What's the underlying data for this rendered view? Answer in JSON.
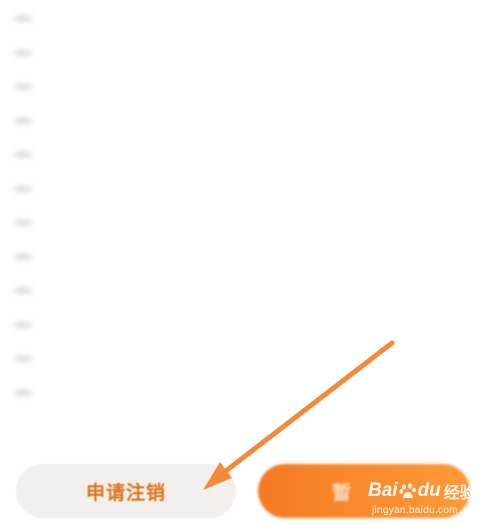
{
  "buttons": {
    "cancel_label": "申请注销",
    "confirm_label": "暂"
  },
  "annotation": {
    "arrow_color": "#f28a3a"
  },
  "watermark": {
    "brand_prefix": "Bai",
    "brand_suffix": "du",
    "product": "经验",
    "url": "jingyan.baidu.com"
  },
  "terms": {
    "lines": [
      "一",
      "一",
      "一",
      "一",
      "一",
      "一",
      "一",
      "一",
      "一",
      "一",
      "一",
      "一"
    ]
  }
}
